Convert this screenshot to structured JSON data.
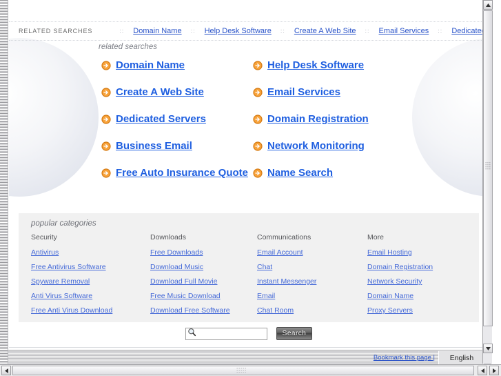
{
  "topbar": {
    "label": "RELATED SEARCHES",
    "separator": "::",
    "links": [
      "Domain Name",
      "Help Desk Software",
      "Create A Web Site",
      "Email Services",
      "Dedicated Servers"
    ]
  },
  "related": {
    "title": "related searches",
    "items": [
      "Domain Name",
      "Help Desk Software",
      "Create A Web Site",
      "Email Services",
      "Dedicated Servers",
      "Domain Registration",
      "Business Email",
      "Network Monitoring",
      "Free Auto Insurance Quote",
      "Name Search"
    ]
  },
  "popular": {
    "title": "popular categories",
    "columns": [
      {
        "heading": "Security",
        "links": [
          "Antivirus",
          "Free Antivirus Software",
          "Spyware Removal",
          "Anti Virus Software",
          "Free Anti Virus Download"
        ]
      },
      {
        "heading": "Downloads",
        "links": [
          "Free Downloads",
          "Download Music",
          "Download Full Movie",
          "Free Music Download",
          "Download Free Software"
        ]
      },
      {
        "heading": "Communications",
        "links": [
          "Email Account",
          "Chat",
          "Instant Messenger",
          "Email",
          "Chat Room"
        ]
      },
      {
        "heading": "More",
        "links": [
          "Email Hosting",
          "Domain Registration",
          "Network Security",
          "Domain Name",
          "Proxy Servers"
        ]
      }
    ]
  },
  "search": {
    "value": "",
    "placeholder": "",
    "button_label": "Search"
  },
  "footer": {
    "bookmark_label": "Bookmark this page |",
    "language": "English"
  },
  "colors": {
    "link_blue": "#2b54c9",
    "heading_blue": "#1f5fe0",
    "category_blue": "#4469d8",
    "arrow_orange": "#e8871a",
    "panel_gray": "#f1f1f1"
  }
}
